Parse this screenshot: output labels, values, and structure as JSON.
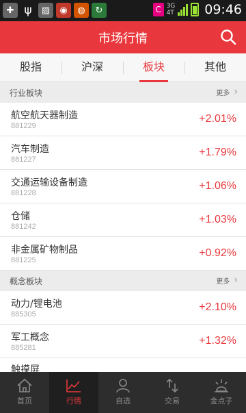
{
  "status_bar": {
    "network": "3G",
    "network_sub": "4T",
    "time": "09:46",
    "c_badge": "C"
  },
  "header": {
    "title": "市场行情"
  },
  "tabs": [
    {
      "label": "股指"
    },
    {
      "label": "沪深"
    },
    {
      "label": "板块"
    },
    {
      "label": "其他"
    }
  ],
  "active_tab": "板块",
  "sections": [
    {
      "title": "行业板块",
      "more": "更多",
      "rows": [
        {
          "name": "航空航天器制造",
          "code": "881229",
          "change": "+2.01%"
        },
        {
          "name": "汽车制造",
          "code": "881227",
          "change": "+1.79%"
        },
        {
          "name": "交通运输设备制造",
          "code": "881228",
          "change": "+1.06%"
        },
        {
          "name": "仓储",
          "code": "881242",
          "change": "+1.03%"
        },
        {
          "name": "非金属矿物制品",
          "code": "881225",
          "change": "+0.92%"
        }
      ]
    },
    {
      "title": "概念板块",
      "more": "更多",
      "rows": [
        {
          "name": "动力/锂电池",
          "code": "885305",
          "change": "+2.10%"
        },
        {
          "name": "军工概念",
          "code": "885281",
          "change": "+1.32%"
        },
        {
          "name": "触摸屏",
          "code": "",
          "change": ""
        }
      ]
    }
  ],
  "bottom_nav": [
    {
      "label": "首页",
      "icon": "home-icon"
    },
    {
      "label": "行情",
      "icon": "chart-icon"
    },
    {
      "label": "自选",
      "icon": "person-icon"
    },
    {
      "label": "交易",
      "icon": "trade-icon"
    },
    {
      "label": "金点子",
      "icon": "idea-icon"
    }
  ],
  "colors": {
    "accent": "#e8383d",
    "nav_bg": "#2d2d2d",
    "status_bg": "#1a1a1a",
    "rise": "#e8383d"
  }
}
